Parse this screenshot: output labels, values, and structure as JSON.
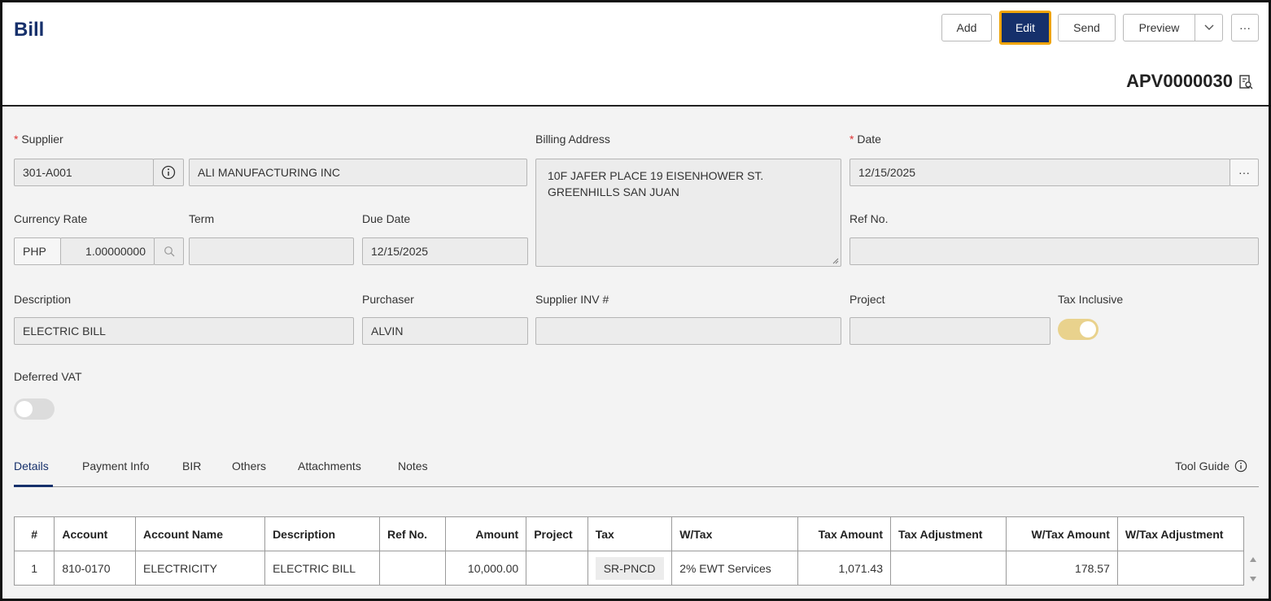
{
  "header": {
    "title": "Bill",
    "buttons": {
      "add": "Add",
      "edit": "Edit",
      "send": "Send",
      "preview": "Preview",
      "more": "···"
    },
    "doc_number": "APV0000030"
  },
  "form": {
    "supplier": {
      "label": "Supplier",
      "code": "301-A001",
      "name": "ALI MANUFACTURING INC"
    },
    "billing_address": {
      "label": "Billing Address",
      "value": "10F JAFER PLACE 19 EISENHOWER ST. GREENHILLS SAN JUAN"
    },
    "date": {
      "label": "Date",
      "value": "12/15/2025",
      "picker": "···"
    },
    "currency_rate": {
      "label": "Currency Rate",
      "currency": "PHP",
      "rate": "1.00000000"
    },
    "term": {
      "label": "Term",
      "value": ""
    },
    "due_date": {
      "label": "Due Date",
      "value": "12/15/2025"
    },
    "ref_no": {
      "label": "Ref No.",
      "value": ""
    },
    "description": {
      "label": "Description",
      "value": "ELECTRIC BILL"
    },
    "purchaser": {
      "label": "Purchaser",
      "value": "ALVIN"
    },
    "supplier_inv": {
      "label": "Supplier INV #",
      "value": ""
    },
    "project": {
      "label": "Project",
      "value": ""
    },
    "tax_inclusive": {
      "label": "Tax Inclusive",
      "on": true,
      "color": "#e9d28d"
    },
    "deferred_vat": {
      "label": "Deferred VAT",
      "on": false,
      "color": "#dcdcdc"
    }
  },
  "tabs": [
    "Details",
    "Payment Info",
    "BIR",
    "Others",
    "Attachments",
    "Notes"
  ],
  "tool_guide": "Tool Guide",
  "table": {
    "headers": [
      "#",
      "Account",
      "Account Name",
      "Description",
      "Ref No.",
      "Amount",
      "Project",
      "Tax",
      "W/Tax",
      "Tax Amount",
      "Tax Adjustment",
      "W/Tax Amount",
      "W/Tax Adjustment"
    ],
    "rows": [
      [
        "1",
        "810-0170",
        "ELECTRICITY",
        "ELECTRIC BILL",
        "",
        "10,000.00",
        "",
        "SR-PNCD",
        "2% EWT Services",
        "1,071.43",
        "",
        "178.57",
        ""
      ]
    ]
  }
}
